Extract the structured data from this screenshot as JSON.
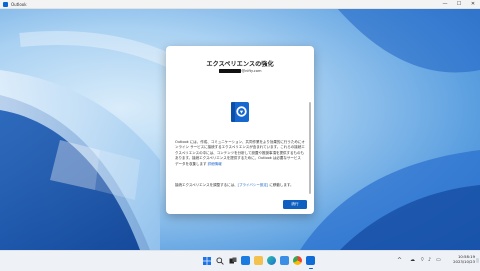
{
  "window": {
    "title": "Outlook",
    "minimize": "—",
    "maximize": "☐",
    "close": "✕"
  },
  "dialog": {
    "title": "エクスペリエンスの強化",
    "account_domain": "@nifty.com",
    "paragraph1": "Outlook には、作成、コミュニケーション、共同作業をより効果的に行うためにオンライン サービスに接続するエクスペリエンスが含まれています。これらの接続エクスペリエンスの中には、コンテンツを分析して設置や推奨事項を提供するものもあります。接続エクスペリエンスを提供するために、Outlook は必要なサービス データを収集します",
    "paragraph1_link": "詳細情報",
    "paragraph2_prefix": "接続エクスペリエンスを調整するには、",
    "paragraph2_link": "[プライバシー設定]",
    "paragraph2_suffix": " に移動します。",
    "next_button": "続行"
  },
  "taskbar": {
    "apps": [
      {
        "name": "start",
        "icon": "windows-logo"
      },
      {
        "name": "search",
        "icon": "search-icon"
      },
      {
        "name": "task-view",
        "icon": "task-view-icon"
      },
      {
        "name": "widgets",
        "icon": "widgets-icon"
      },
      {
        "name": "file-explorer",
        "icon": "folder-icon"
      },
      {
        "name": "edge",
        "icon": "edge-icon"
      },
      {
        "name": "store",
        "icon": "store-icon"
      },
      {
        "name": "chrome",
        "icon": "chrome-icon"
      },
      {
        "name": "outlook",
        "icon": "outlook-icon"
      }
    ],
    "tray_chevron": "^",
    "time": "10:58:19",
    "date": "2023/10/23"
  },
  "colors": {
    "accent": "#0f5fc0",
    "link": "#1a62c7"
  }
}
